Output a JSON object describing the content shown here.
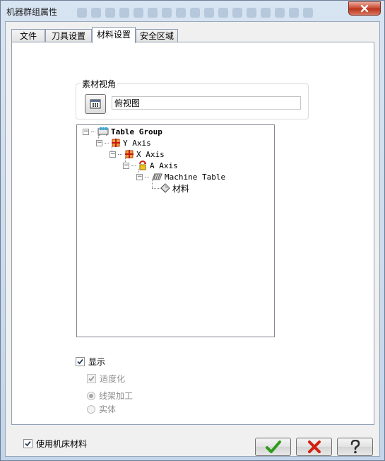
{
  "window": {
    "title": "机器群组属性",
    "accent": "#c7442a"
  },
  "tabs": [
    {
      "label": "文件"
    },
    {
      "label": "刀具设置"
    },
    {
      "label": "材料设置",
      "active": true
    },
    {
      "label": "安全区域"
    }
  ],
  "stock_view": {
    "group_label": "素材视角",
    "button_icon": "view-grid-icon",
    "value": "俯视图"
  },
  "tree": {
    "nodes": [
      {
        "label": "Table Group",
        "icon": "table-group-icon",
        "bold": true
      },
      {
        "label": "Y Axis",
        "icon": "linear-axis-icon"
      },
      {
        "label": "X Axis",
        "icon": "linear-axis-icon"
      },
      {
        "label": "A Axis",
        "icon": "rotary-axis-icon"
      },
      {
        "label": "Machine Table",
        "icon": "machine-table-icon"
      },
      {
        "label": "材料",
        "icon": "stock-diamond-icon"
      }
    ]
  },
  "display": {
    "show_label": "显示",
    "show_checked": true,
    "fit_label": "适度化",
    "fit_checked": true,
    "wireframe_label": "线架加工",
    "wireframe_selected": true,
    "solid_label": "实体",
    "solid_selected": false
  },
  "use_machine_stock": {
    "label": "使用机床材料",
    "checked": true
  },
  "buttons": {
    "ok_icon": "green-check-icon",
    "cancel_icon": "red-x-icon",
    "help_icon": "question-icon"
  },
  "colors": {
    "ok": "#2f9a1b",
    "cancel": "#d02010",
    "help": "#303030"
  }
}
